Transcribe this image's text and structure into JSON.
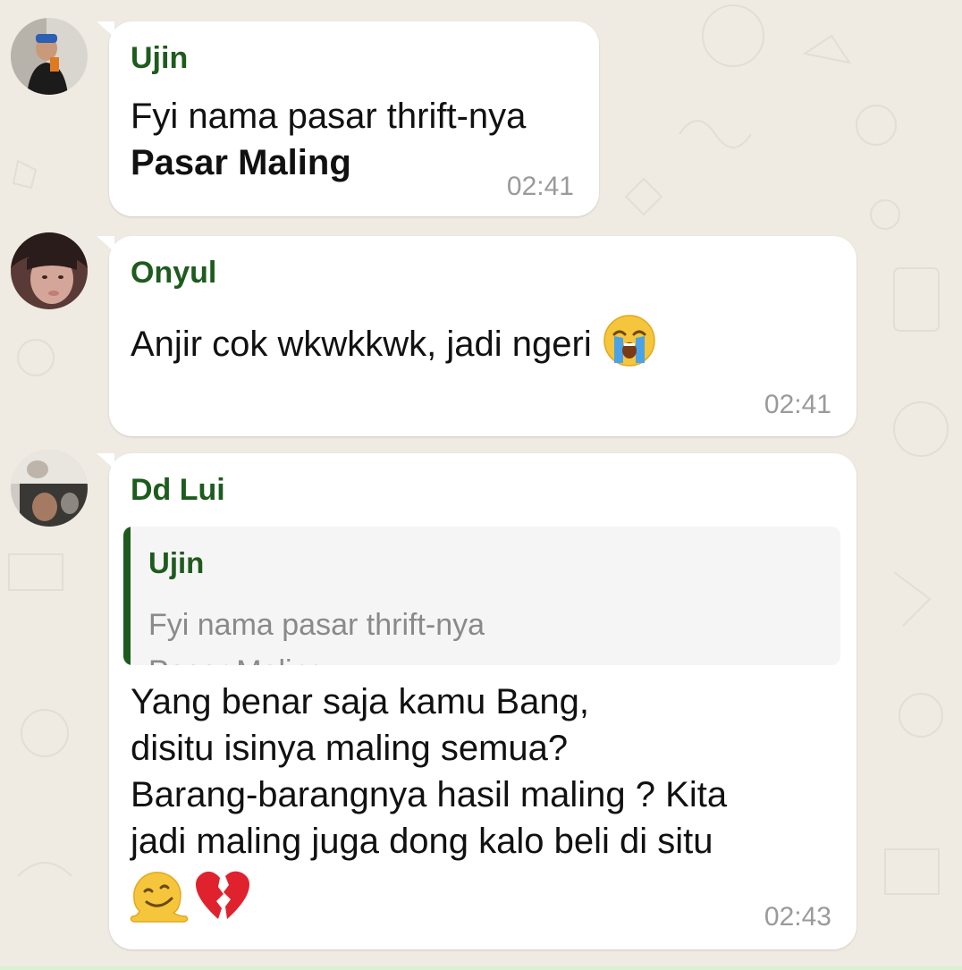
{
  "messages": [
    {
      "sender": "Ujin",
      "lines": [
        "Fyi nama pasar thrift-nya",
        "Pasar Maling"
      ],
      "time": "02:41"
    },
    {
      "sender": "Onyul",
      "text": "Anjir cok wkwkkwk, jadi ngeri",
      "emoji": "loudly-crying-face",
      "time": "02:41"
    },
    {
      "sender": "Dd Lui",
      "quote": {
        "sender": "Ujin",
        "lines": [
          "Fyi nama pasar thrift-nya",
          "Pasar Maling"
        ]
      },
      "lines": [
        "Yang benar saja kamu Bang,",
        "disitu isinya maling semua?",
        "Barang-barangnya hasil maling ? Kita",
        "jadi maling juga dong kalo beli di situ"
      ],
      "emojis": [
        "melting-face",
        "broken-heart"
      ],
      "time": "02:43"
    }
  ],
  "colors": {
    "background": "#efeae2",
    "bubble": "#ffffff",
    "sender_name": "#1e5b1e",
    "timestamp": "#9a9a9a"
  }
}
